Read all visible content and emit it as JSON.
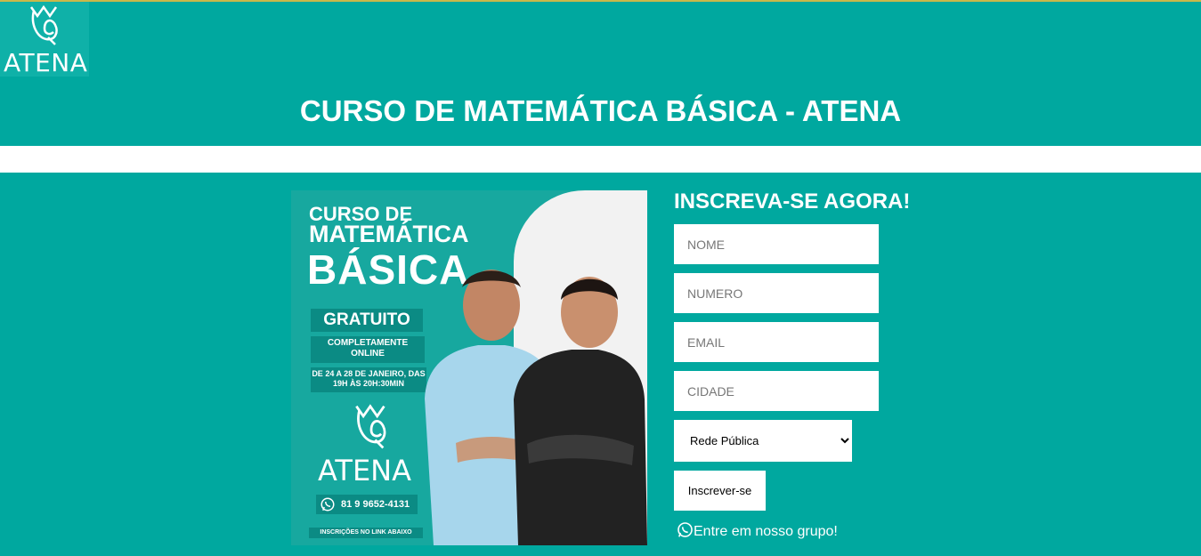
{
  "logo": {
    "text": "ATENA"
  },
  "page_title": "CURSO DE MATEMÁTICA BÁSICA - ATENA",
  "poster": {
    "line1": "CURSO DE",
    "line2": "MATEMÁTICA",
    "line3": "BÁSICA",
    "gratuito": "GRATUITO",
    "online": "COMPLETAMENTE ONLINE",
    "dates": "DE 24 A 28 DE JANEIRO, DAS 19H ÀS 20H:30MIN",
    "brand": "ATENA",
    "phone": "81 9 9652-4131",
    "inscricoes": "INSCRIÇÕES NO LINK ABAIXO"
  },
  "form": {
    "title": "INSCREVA-SE AGORA!",
    "nome_placeholder": "NOME",
    "numero_placeholder": "NUMERO",
    "email_placeholder": "EMAIL",
    "cidade_placeholder": "CIDADE",
    "select_value": "Rede Pública",
    "submit_label": "Inscrever-se",
    "group_link": "Entre em nosso grupo!"
  },
  "colors": {
    "teal": "#00a89f",
    "white": "#ffffff"
  },
  "icons": {
    "whatsapp": "whatsapp-icon",
    "owl": "atena-owl-icon"
  }
}
